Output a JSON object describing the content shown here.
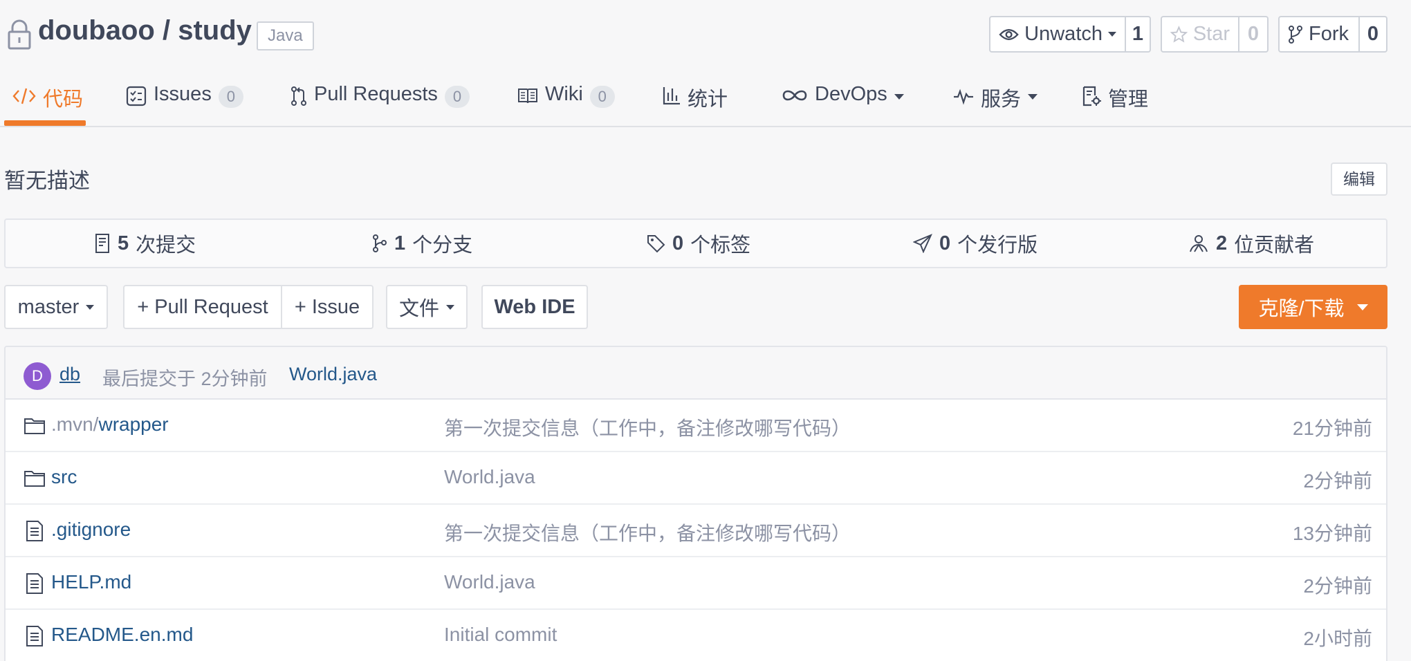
{
  "repo": {
    "owner": "doubaoo",
    "separator": " / ",
    "name": "study",
    "language": "Java"
  },
  "actions": {
    "watch": {
      "label": "Unwatch",
      "count": "1"
    },
    "star": {
      "label": "Star",
      "count": "0"
    },
    "fork": {
      "label": "Fork",
      "count": "0"
    }
  },
  "tabs": [
    {
      "label": "代码",
      "icon": "code-icon",
      "active": true
    },
    {
      "label": "Issues",
      "icon": "issues-icon",
      "count": "0"
    },
    {
      "label": "Pull Requests",
      "icon": "pull-request-icon",
      "count": "0"
    },
    {
      "label": "Wiki",
      "icon": "wiki-icon",
      "count": "0"
    },
    {
      "label": "统计",
      "icon": "chart-icon"
    },
    {
      "label": "DevOps",
      "icon": "infinity-icon",
      "dropdown": true
    },
    {
      "label": "服务",
      "icon": "pulse-icon",
      "dropdown": true
    },
    {
      "label": "管理",
      "icon": "settings-doc-icon"
    }
  ],
  "description": "暂无描述",
  "edit_label": "编辑",
  "stats": [
    {
      "num": "5",
      "label": "次提交",
      "icon": "commit-icon"
    },
    {
      "num": "1",
      "label": "个分支",
      "icon": "branch-icon"
    },
    {
      "num": "0",
      "label": "个标签",
      "icon": "tag-icon"
    },
    {
      "num": "0",
      "label": "个发行版",
      "icon": "release-icon"
    },
    {
      "num": "2",
      "label": "位贡献者",
      "icon": "contributors-icon"
    }
  ],
  "toolbar": {
    "branch": "master",
    "pull_request": "+ Pull Request",
    "issue": "+ Issue",
    "file": "文件",
    "web_ide": "Web IDE",
    "clone": "克隆/下载"
  },
  "last_commit": {
    "avatar_letter": "D",
    "author": "db",
    "time": "最后提交于 2分钟前",
    "message": "World.java"
  },
  "files": [
    {
      "type": "folder",
      "prefix": ".mvn/",
      "name": "wrapper",
      "message": "第一次提交信息（工作中，备注修改哪写代码）",
      "time": "21分钟前"
    },
    {
      "type": "folder",
      "prefix": "",
      "name": "src",
      "message": "World.java",
      "time": "2分钟前"
    },
    {
      "type": "file",
      "prefix": "",
      "name": ".gitignore",
      "message": "第一次提交信息（工作中，备注修改哪写代码）",
      "time": "13分钟前"
    },
    {
      "type": "file",
      "prefix": "",
      "name": "HELP.md",
      "message": "World.java",
      "time": "2分钟前"
    },
    {
      "type": "file",
      "prefix": "",
      "name": "README.en.md",
      "message": "Initial commit",
      "time": "2小时前"
    }
  ],
  "colors": {
    "accent": "#ef7a2b",
    "link": "#24588a",
    "muted": "#8c92a4",
    "text": "#40485b",
    "avatar": "#8e5bd1"
  }
}
